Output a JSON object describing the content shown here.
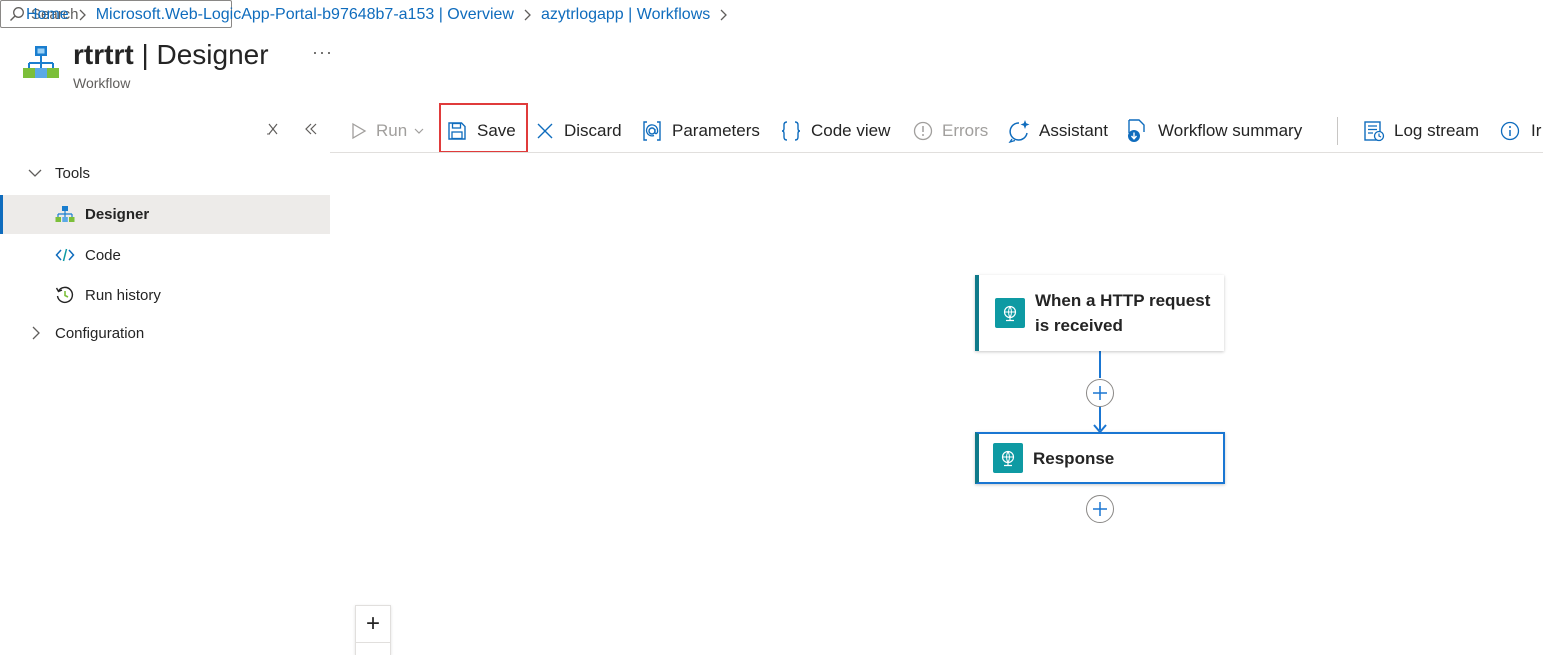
{
  "breadcrumb": {
    "items": [
      "Home",
      "Microsoft.Web-LogicApp-Portal-b97648b7-a153 | Overview",
      "azytrlogapp | Workflows"
    ]
  },
  "header": {
    "title_bold": "rtrtrt",
    "title_rest": " | Designer",
    "subtitle": "Workflow",
    "more": "···"
  },
  "sidebar": {
    "search_placeholder": "Search",
    "groups": [
      {
        "label": "Tools",
        "expanded": true
      },
      {
        "label": "Configuration",
        "expanded": false
      }
    ],
    "items": [
      {
        "label": "Designer",
        "icon": "designer-icon",
        "selected": true
      },
      {
        "label": "Code",
        "icon": "code-icon"
      },
      {
        "label": "Run history",
        "icon": "run-history-icon"
      }
    ]
  },
  "toolbar": {
    "run": "Run",
    "save": "Save",
    "discard": "Discard",
    "parameters": "Parameters",
    "code_view": "Code view",
    "errors": "Errors",
    "assistant": "Assistant",
    "workflow_summary": "Workflow summary",
    "log_stream": "Log stream",
    "info_partial": "Ir"
  },
  "canvas": {
    "trigger": {
      "title_line1": "When a HTTP request",
      "title_line2": "is received",
      "icon": "http-request-icon"
    },
    "action": {
      "title": "Response",
      "icon": "http-response-icon"
    },
    "zoom_in_label": "+"
  },
  "colors": {
    "link": "#0f6cbd",
    "accent": "#0f6cbd",
    "highlight": "#e03b3b",
    "card_icon": "#0e9aa3",
    "connector": "#1a76d2"
  }
}
